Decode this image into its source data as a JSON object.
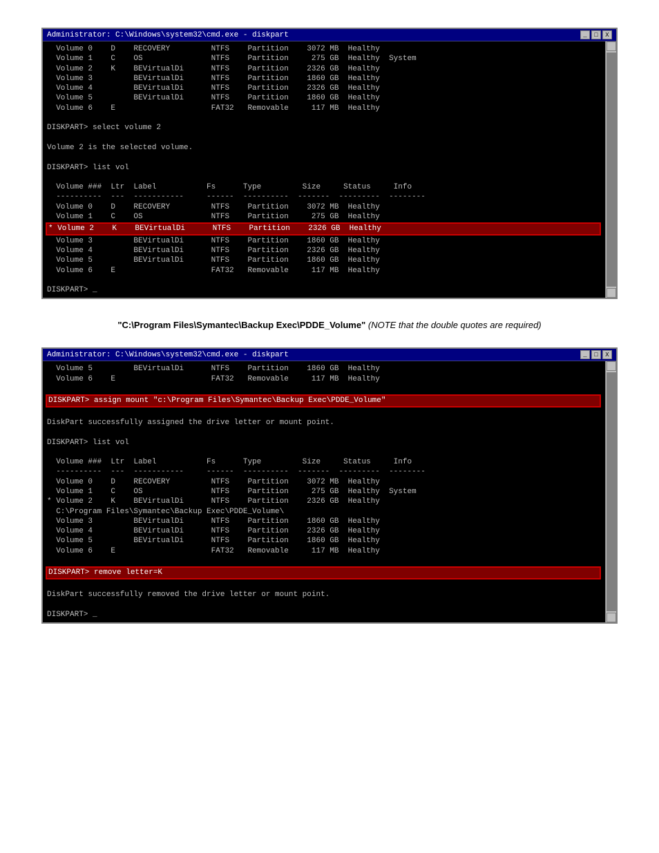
{
  "window1": {
    "title": "Administrator: C:\\Windows\\system32\\cmd.exe - diskpart",
    "lines": [
      "  Volume 0    D    RECOVERY         NTFS    Partition    3072 MB  Healthy",
      "  Volume 1    C    OS               NTFS    Partition     275 GB  Healthy  System",
      "  Volume 2    K    BEVirtualDi      NTFS    Partition    2326 GB  Healthy",
      "  Volume 3         BEVirtualDi      NTFS    Partition    1860 GB  Healthy",
      "  Volume 4         BEVirtualDi      NTFS    Partition    2326 GB  Healthy",
      "  Volume 5         BEVirtualDi      NTFS    Partition    1860 GB  Healthy",
      "  Volume 6    E                     FAT32   Removable     117 MB  Healthy",
      "",
      "DISKPART> select volume 2",
      "",
      "Volume 2 is the selected volume.",
      "",
      "DISKPART> list vol",
      "",
      "  Volume ###  Ltr  Label           Fs      Type         Size     Status     Info",
      "  ----------  ---  -----------     ------  ----------  -------  ---------  --------",
      "  Volume 0    D    RECOVERY         NTFS    Partition    3072 MB  Healthy",
      "  Volume 1    C    OS               NTFS    Partition     275 GB  Healthy",
      "* Volume 2    K    BEVirtualDi      NTFS    Partition    2326 GB  Healthy",
      "  Volume 3         BEVirtualDi      NTFS    Partition    1860 GB  Healthy",
      "  Volume 4         BEVirtualDi      NTFS    Partition    2326 GB  Healthy",
      "  Volume 5         BEVirtualDi      NTFS    Partition    1860 GB  Healthy",
      "  Volume 6    E                     FAT32   Removable     117 MB  Healthy",
      "",
      "DISKPART> _"
    ],
    "highlighted_line_index": 18,
    "title_note": "\"C:\\Program Files\\Symantec\\Backup Exec\\PDDE_Volume\"",
    "title_note_suffix": " (NOTE that the double quotes are required)"
  },
  "window2": {
    "title": "Administrator: C:\\Windows\\system32\\cmd.exe - diskpart",
    "lines": [
      "  Volume 5         BEVirtualDi      NTFS    Partition    1860 GB  Healthy",
      "  Volume 6    E                     FAT32   Removable     117 MB  Healthy",
      "",
      "DISKPART> assign mount \"c:\\Program Files\\Symantec\\Backup Exec\\PDDE_Volume\"",
      "",
      "DiskPart successfully assigned the drive letter or mount point.",
      "",
      "DISKPART> list vol",
      "",
      "  Volume ###  Ltr  Label           Fs      Type         Size     Status     Info",
      "  ----------  ---  -----------     ------  ----------  -------  ---------  --------",
      "  Volume 0    D    RECOVERY         NTFS    Partition    3072 MB  Healthy",
      "  Volume 1    C    OS               NTFS    Partition     275 GB  Healthy  System",
      "* Volume 2    K    BEVirtualDi      NTFS    Partition    2326 GB  Healthy",
      "  C:\\Program Files\\Symantec\\Backup Exec\\PDDE_Volume\\",
      "  Volume 3         BEVirtualDi      NTFS    Partition    1860 GB  Healthy",
      "  Volume 4         BEVirtualDi      NTFS    Partition    2326 GB  Healthy",
      "  Volume 5         BEVirtualDi      NTFS    Partition    1860 GB  Healthy",
      "  Volume 6    E                     FAT32   Removable     117 MB  Healthy",
      "",
      "DISKPART> remove letter=K",
      "",
      "DiskPart successfully removed the drive letter or mount point.",
      "",
      "DISKPART> _"
    ],
    "highlighted_lines": [
      3,
      20
    ]
  },
  "ui": {
    "titlebar_minimize": "_",
    "titlebar_restore": "□",
    "titlebar_close": "X",
    "scrollbar_up": "▲",
    "scrollbar_down": "▼"
  }
}
